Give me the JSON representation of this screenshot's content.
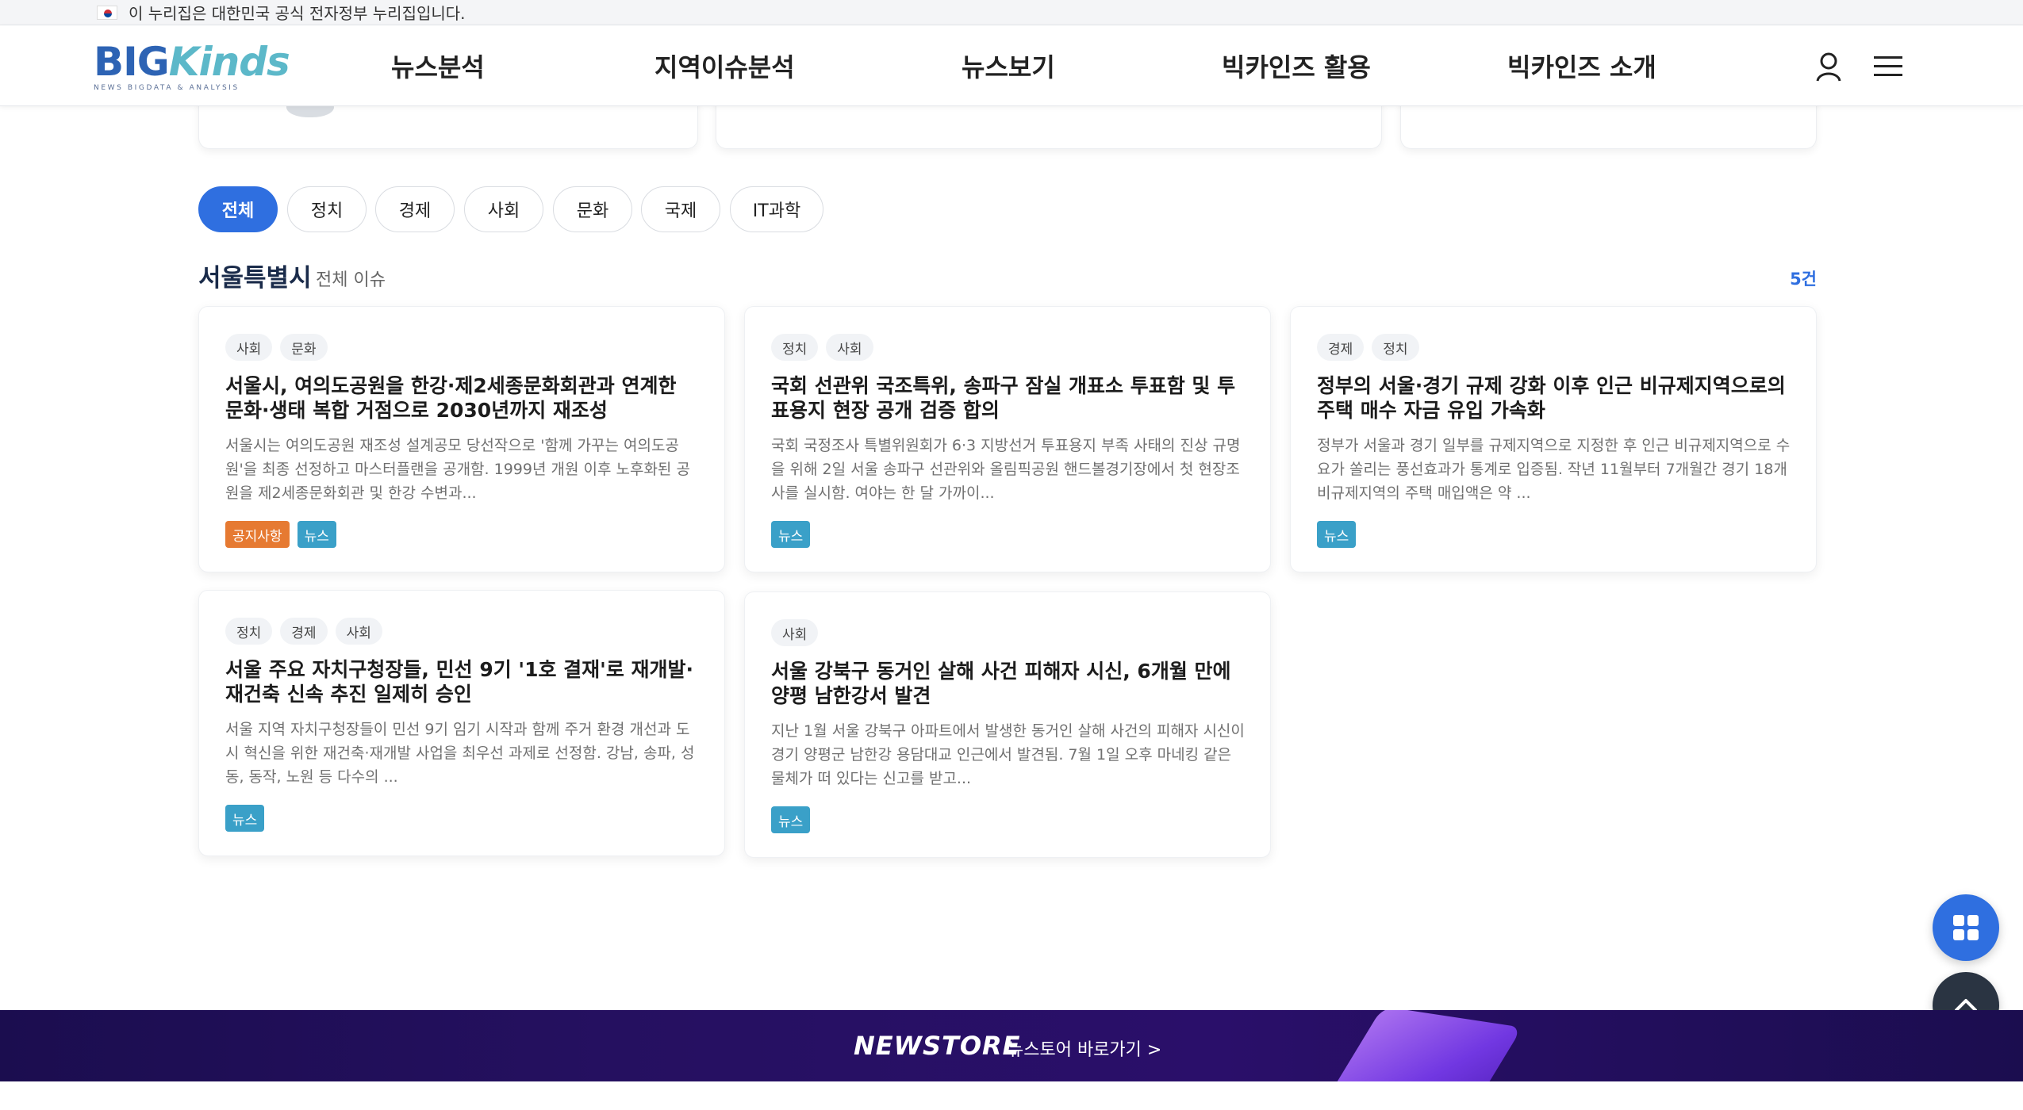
{
  "gov_banner": {
    "text": "이 누리집은 대한민국 공식 전자정부 누리집입니다."
  },
  "header": {
    "logo_main_a": "BIG",
    "logo_main_b": "Kinds",
    "logo_sub": "NEWS BIGDATA & ANALYSIS",
    "nav": [
      "뉴스분석",
      "지역이슈분석",
      "뉴스보기",
      "빅카인즈 활용",
      "빅카인즈 소개"
    ]
  },
  "filters": {
    "chips": [
      "전체",
      "정치",
      "경제",
      "사회",
      "문화",
      "국제",
      "IT과학"
    ],
    "active": "전체"
  },
  "section": {
    "title": "서울특별시",
    "subtitle": "전체 이슈",
    "count": "5건"
  },
  "articles": [
    {
      "tags": [
        "사회",
        "문화"
      ],
      "title": "서울시, 여의도공원을 한강·제2세종문화회관과 연계한 문화·생태 복합 거점으로 2030년까지 재조성",
      "desc": "서울시는 여의도공원 재조성 설계공모 당선작으로 '함께 가꾸는 여의도공원'을 최종 선정하고 마스터플랜을 공개함. 1999년 개원 이후 노후화된 공원을 제2세종문화회관 및 한강 수변과...",
      "badges": [
        "공지사항",
        "뉴스"
      ]
    },
    {
      "tags": [
        "정치",
        "사회"
      ],
      "title": "국회 선관위 국조특위, 송파구 잠실 개표소 투표함 및 투표용지 현장 공개 검증 합의",
      "desc": "국회 국정조사 특별위원회가 6·3 지방선거 투표용지 부족 사태의 진상 규명을 위해 2일 서울 송파구 선관위와 올림픽공원 핸드볼경기장에서 첫 현장조사를 실시함. 여야는 한 달 가까이...",
      "badges": [
        "뉴스"
      ]
    },
    {
      "tags": [
        "경제",
        "정치"
      ],
      "title": "정부의 서울·경기 규제 강화 이후 인근 비규제지역으로의 주택 매수 자금 유입 가속화",
      "desc": "정부가 서울과 경기 일부를 규제지역으로 지정한 후 인근 비규제지역으로 수요가 쏠리는 풍선효과가 통계로 입증됨. 작년 11월부터 7개월간 경기 18개 비규제지역의 주택 매입액은 약 ...",
      "badges": [
        "뉴스"
      ]
    },
    {
      "tags": [
        "정치",
        "경제",
        "사회"
      ],
      "title": "서울 주요 자치구청장들, 민선 9기 '1호 결재'로 재개발·재건축 신속 추진 일제히 승인",
      "desc": "서울 지역 자치구청장들이 민선 9기 임기 시작과 함께 주거 환경 개선과 도시 혁신을 위한 재건축·재개발 사업을 최우선 과제로 선정함. 강남, 송파, 성동, 동작, 노원 등 다수의 ...",
      "badges": [
        "뉴스"
      ]
    },
    {
      "tags": [
        "사회"
      ],
      "title": "서울 강북구 동거인 살해 사건 피해자 시신, 6개월 만에 양평 남한강서 발견",
      "desc": "지난 1월 서울 강북구 아파트에서 발생한 동거인 살해 사건의 피해자 시신이 경기 양평군 남한강 용담대교 인근에서 발견됨. 7월 1일 오후 마네킹 같은 물체가 떠 있다는 신고를 받고...",
      "badges": [
        "뉴스"
      ]
    }
  ],
  "footer": {
    "logo": "NEWSTORE",
    "link": "뉴스토어 바로가기 >"
  },
  "icons": {
    "user": "user-icon",
    "menu": "hamburger-menu-icon",
    "grid": "grid-icon",
    "top": "chevron-up-icon"
  },
  "colors": {
    "accent": "#2f6fe0",
    "news_badge": "#3aa0c8",
    "notice_badge": "#e67a32",
    "footer_bg": "#1b0d4f"
  }
}
